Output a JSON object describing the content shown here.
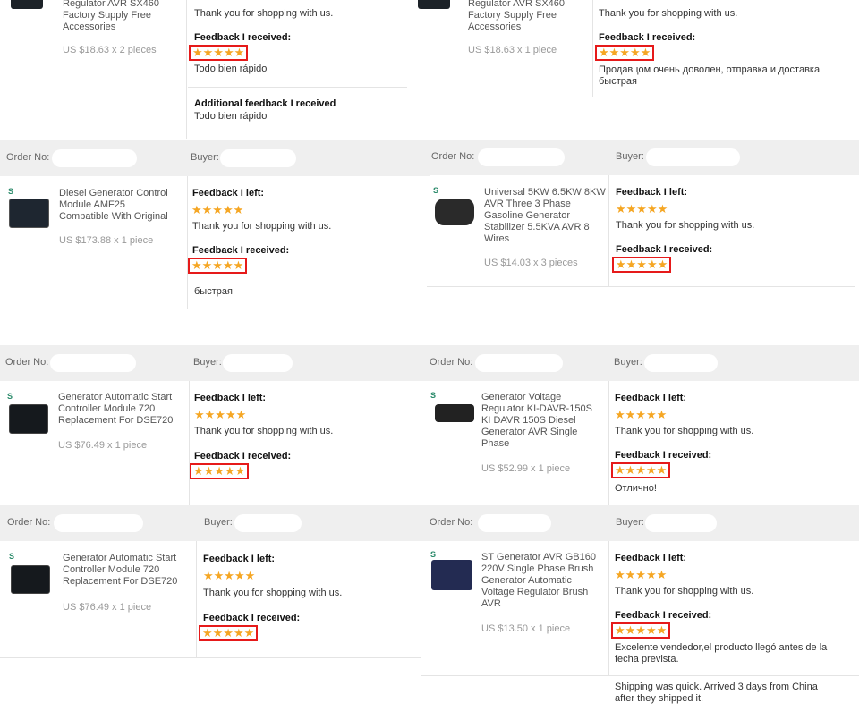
{
  "labels": {
    "order_no": "Order No:",
    "buyer": "Buyer:",
    "fb_left": "Feedback I left:",
    "fb_received": "Feedback I received:",
    "additional": "Additional feedback I received"
  },
  "stars_left": "★★★★★",
  "stars_received": "★★★★★",
  "thanks": "Thank you for shopping with us.",
  "cards": {
    "c1": {
      "title": "Regulator AVR SX460\nFactory Supply Free\nAccessories",
      "price": "US $18.63 x 2 pieces",
      "received_text": "Todo bien rápido",
      "additional_text": "Todo bien rápido"
    },
    "c2": {
      "title": "Regulator AVR SX460\nFactory Supply Free\nAccessories",
      "price": "US $18.63 x 1 piece",
      "received_text": "Продавцом очень доволен, отправка и доставка\nбыстрая"
    },
    "c3": {
      "title": "Diesel Generator Control\nModule AMF25\nCompatible With Original",
      "price": "US $173.88 x 1 piece",
      "received_text": "быстрая"
    },
    "c4": {
      "title": "Universal 5KW 6.5KW 8KW\nAVR Three 3 Phase\nGasoline Generator\nStabilizer 5.5KVA AVR 8\nWires",
      "price": "US $14.03 x 3 pieces"
    },
    "c5": {
      "title": "Generator Automatic Start\nController Module 720\nReplacement For DSE720",
      "price": "US $76.49 x 1 piece"
    },
    "c6": {
      "title": "Generator Voltage\nRegulator KI-DAVR-150S\nKI DAVR 150S Diesel\nGenerator AVR Single\nPhase",
      "price": "US $52.99 x 1 piece",
      "received_text": "Отлично!"
    },
    "c7": {
      "title": "Generator Automatic Start\nController Module 720\nReplacement For DSE720",
      "price": "US $76.49 x 1 piece"
    },
    "c8": {
      "title": "ST Generator AVR GB160\n220V Single Phase Brush\nGenerator Automatic\nVoltage Regulator Brush\nAVR",
      "price": "US $13.50 x 1 piece",
      "received_text": "Excelente vendedor,el producto llegó antes de la\nfecha prevista.",
      "additional_text": "Shipping was quick. Arrived 3 days from China\nafter they shipped it."
    }
  }
}
